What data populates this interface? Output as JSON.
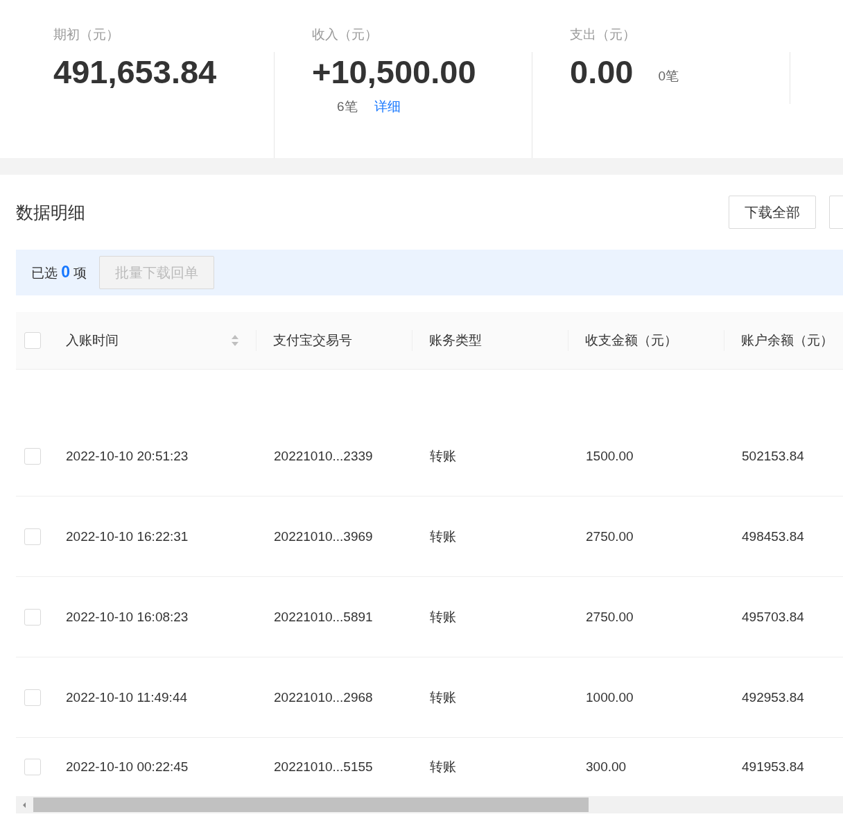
{
  "summary": [
    {
      "label": "期初（元）",
      "value": "491,653.84"
    },
    {
      "label": "收入（元）",
      "value": "+10,500.00",
      "count": "6笔",
      "link": "详细",
      "count_below": true
    },
    {
      "label": "支出（元）",
      "value": "0.00",
      "count": "0笔",
      "count_below": false
    }
  ],
  "section": {
    "title": "数据明细",
    "buttons": [
      "下载全部"
    ]
  },
  "selection": {
    "prefix": "已选",
    "count": "0",
    "suffix": "项",
    "batch_button": {
      "label": "批量下载回单",
      "disabled": true
    }
  },
  "table": {
    "select_all": {
      "checked": false
    },
    "columns": [
      {
        "label": "入账时间",
        "sortable": true
      },
      {
        "label": "支付宝交易号",
        "sortable": false
      },
      {
        "label": "账务类型",
        "sortable": false
      },
      {
        "label": "收支金额（元）",
        "sortable": false
      },
      {
        "label": "账户余额（元）",
        "sortable": false
      }
    ],
    "rows": [
      {
        "checked": false,
        "cells": [
          "2022-10-10 20:51:23",
          "20221010...2339",
          "转账",
          "1500.00",
          "502153.84"
        ]
      },
      {
        "checked": false,
        "cells": [
          "2022-10-10 16:22:31",
          "20221010...3969",
          "转账",
          "2750.00",
          "498453.84"
        ]
      },
      {
        "checked": false,
        "cells": [
          "2022-10-10 16:08:23",
          "20221010...5891",
          "转账",
          "2750.00",
          "495703.84"
        ]
      },
      {
        "checked": false,
        "cells": [
          "2022-10-10 11:49:44",
          "20221010...2968",
          "转账",
          "1000.00",
          "492953.84"
        ]
      },
      {
        "checked": false,
        "cells": [
          "2022-10-10 00:22:45",
          "20221010...5155",
          "转账",
          "300.00",
          "491953.84"
        ]
      }
    ]
  }
}
